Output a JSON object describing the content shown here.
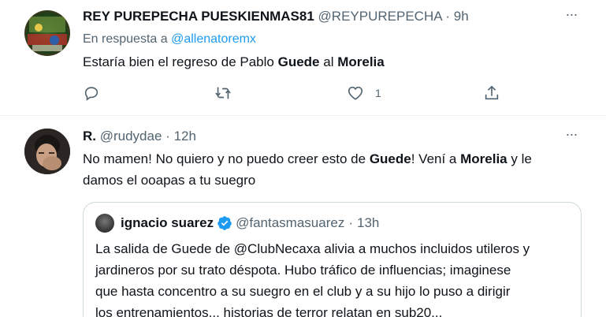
{
  "tweet1": {
    "name": "REY PUREPECHA PUESKIENMAS81",
    "handle": "@REYPUREPECHA",
    "dot": "·",
    "time": "9h",
    "more": "···",
    "reply_prefix": "En respuesta a",
    "reply_mention": "@allenatoremx",
    "text_parts": [
      "Estaría bien el regreso de Pablo ",
      "Guede",
      " al ",
      "Morelia"
    ],
    "like_count": "1"
  },
  "tweet2": {
    "name": "R.",
    "handle": "@rudydae",
    "dot": "·",
    "time": "12h",
    "more": "···",
    "line1_parts": [
      "No mamen! No quiero y no puedo creer esto de ",
      "Guede",
      "! Vení a ",
      "Morelia",
      " y le"
    ],
    "line2": "damos el ooapas a tu suegro"
  },
  "quote": {
    "name": "ignacio suarez",
    "handle": "@fantasmasuarez",
    "dot": "·",
    "time": "13h",
    "lines": [
      "La salida de Guede de @ClubNecaxa alivia a muchos incluidos utileros y",
      "jardineros por su trato déspota. Hubo tráfico de influencias; imaginese",
      "que hasta concentro a su suegro en el club y a su hijo lo puso a dirigir",
      "los entrenamientos... historias de terror relatan en sub20..."
    ]
  },
  "colors": {
    "text": "#0f1419",
    "secondary": "#536471",
    "link": "#1d9bf0",
    "border": "#cfd9de",
    "verified": "#1d9bf0"
  },
  "icons": [
    "reply-icon",
    "retweet-icon",
    "like-icon",
    "share-icon",
    "more-icon",
    "verified-icon"
  ]
}
